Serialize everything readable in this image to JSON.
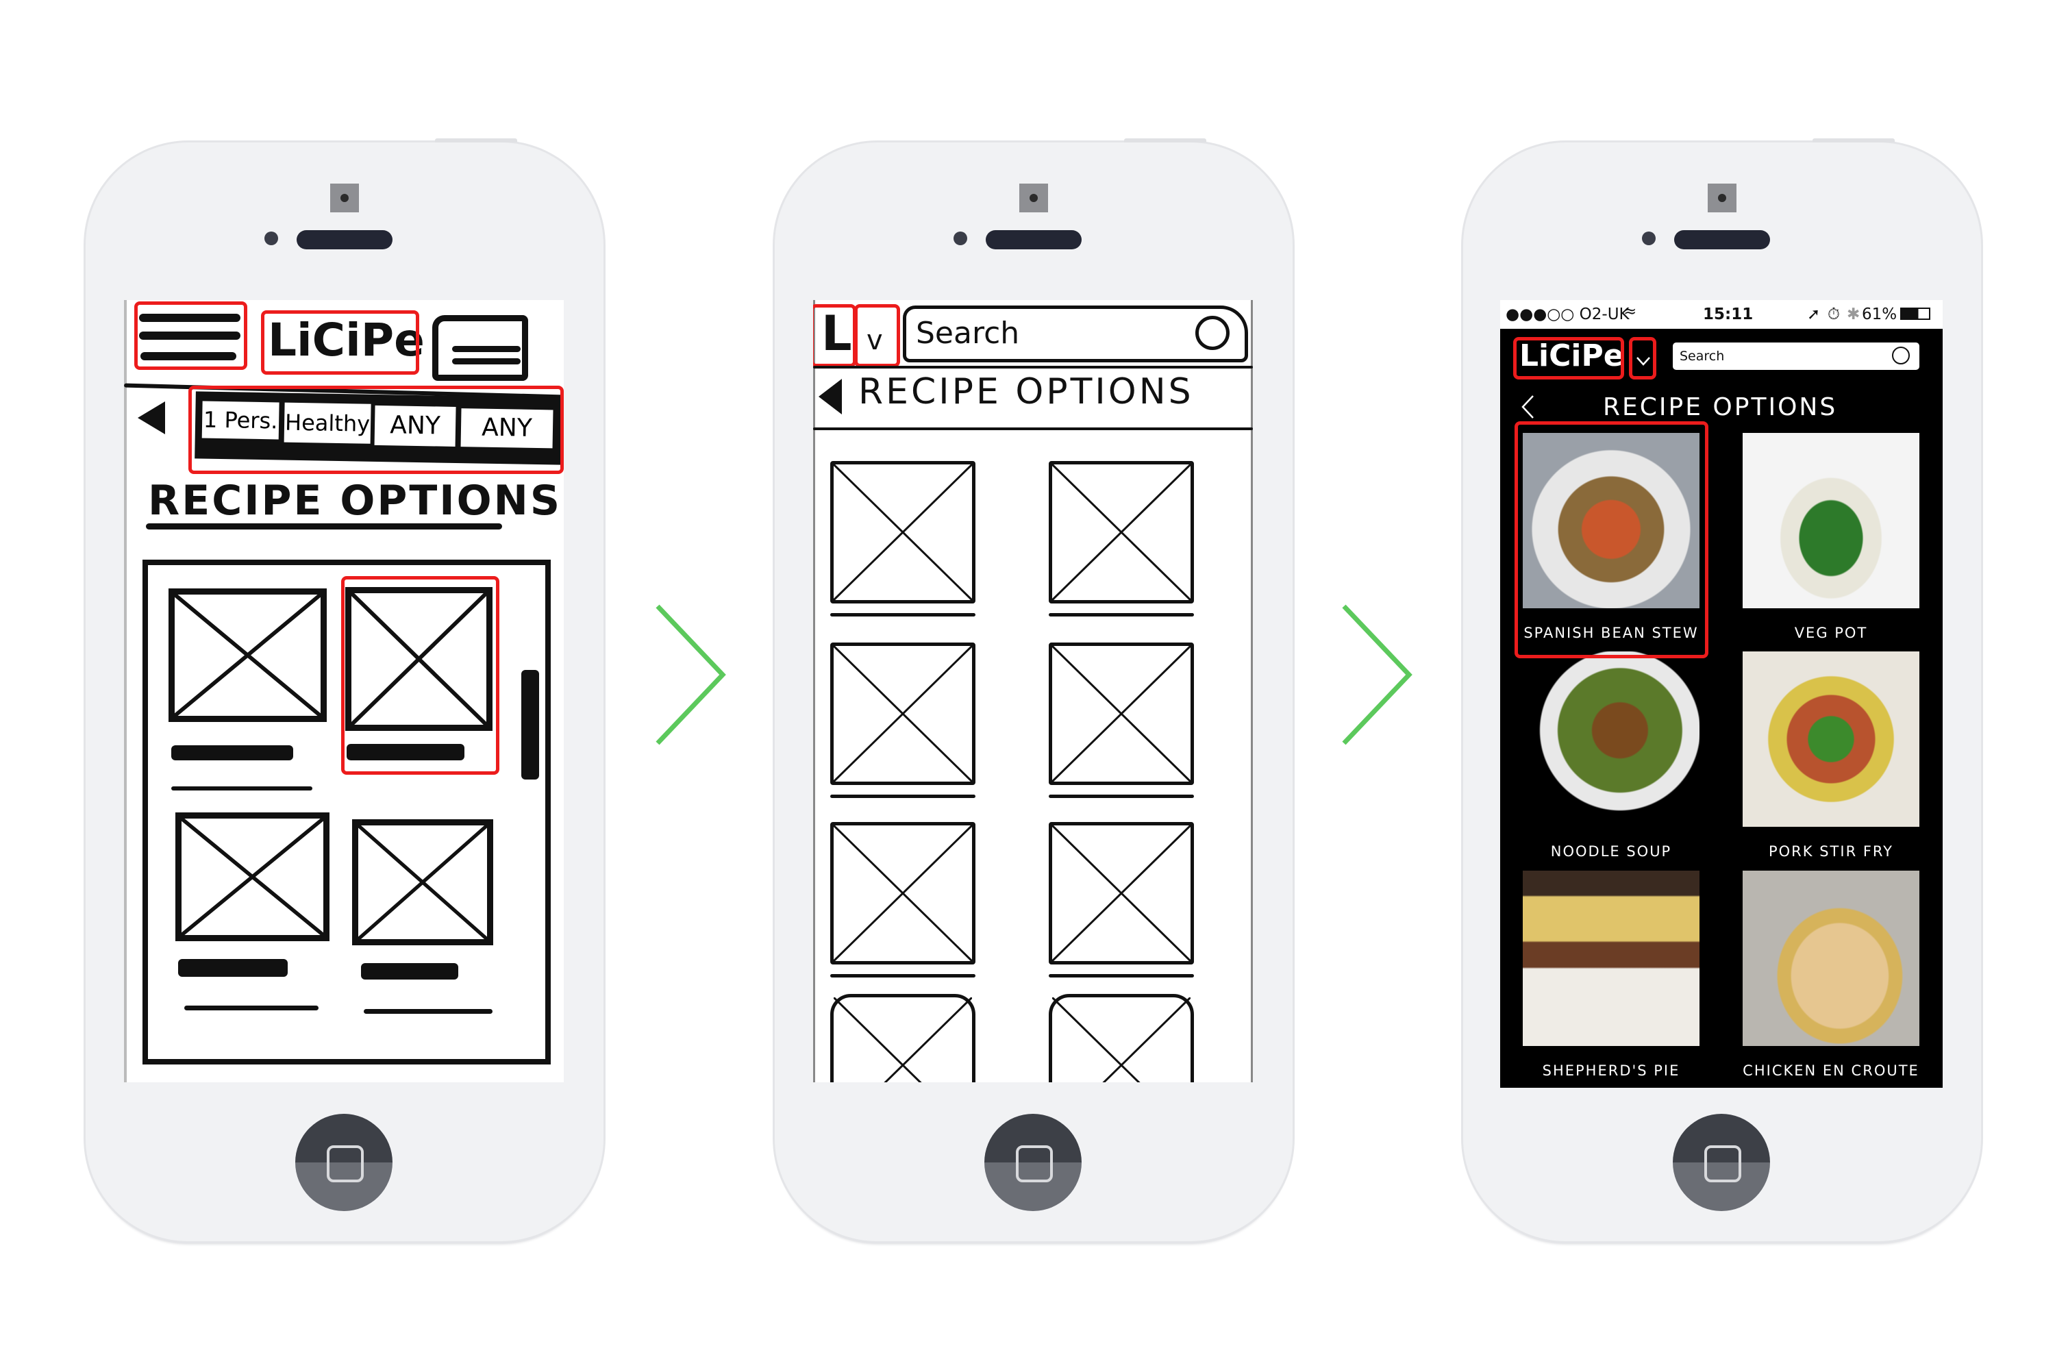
{
  "phone1": {
    "logo": "LiCiPe",
    "filters": [
      "1 Pers.",
      "Healthy",
      "ANY",
      "ANY"
    ],
    "title": "RECIPE OPTIONS",
    "icons": [
      "hamburger-menu-icon",
      "layers-icon",
      "back-triangle-icon"
    ]
  },
  "phone2": {
    "logo": "L",
    "dropdown": "v",
    "search_placeholder": "Search",
    "title": "RECIPE OPTIONS"
  },
  "phone3": {
    "status": {
      "carrier": "●●●○○ O2-UK",
      "time": "15:11",
      "battery": "61%"
    },
    "logo": "LiCiPe",
    "search_placeholder": "Search",
    "title": "RECIPE OPTIONS",
    "recipes": [
      {
        "label": "SPANISH BEAN STEW"
      },
      {
        "label": "VEG POT"
      },
      {
        "label": "NOODLE SOUP"
      },
      {
        "label": "PORK STIR FRY"
      },
      {
        "label": "SHEPHERD'S PIE"
      },
      {
        "label": "CHICKEN EN CROUTE"
      }
    ]
  },
  "colors": {
    "highlight": "#ec1c1c",
    "arrow": "#5cc95c",
    "app_bg": "#000000"
  }
}
